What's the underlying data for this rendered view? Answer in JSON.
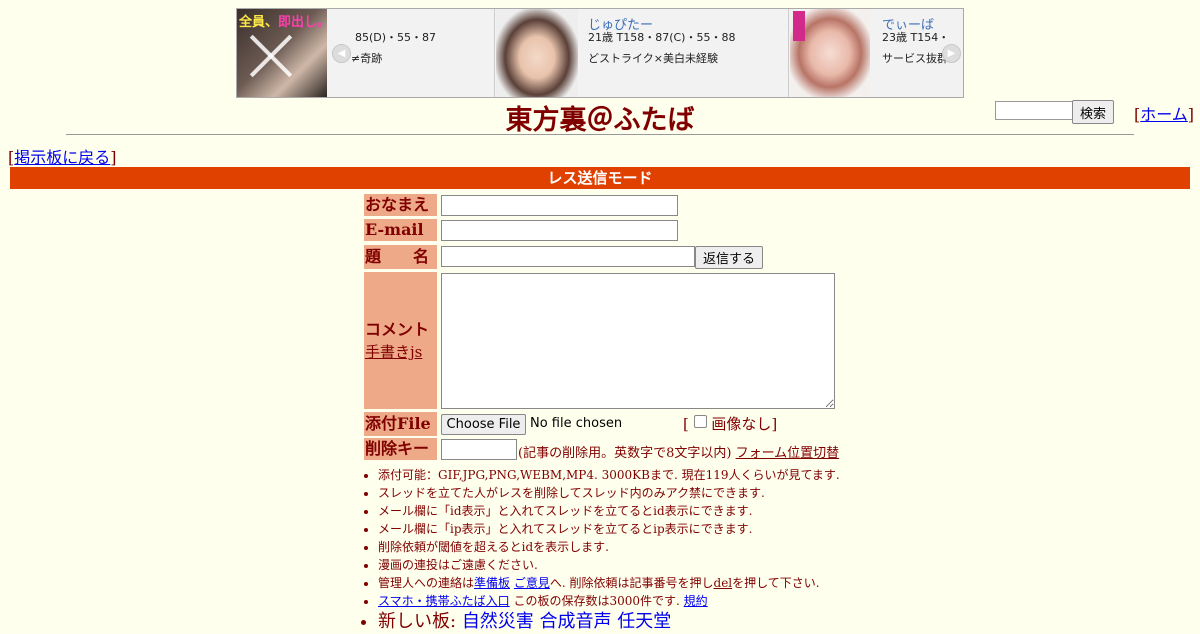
{
  "banner": {
    "ad1": {
      "badge": "全員、",
      "badge_pink": "即出し。",
      "line1": "85(D)・55・87",
      "line2": "≠奇跡"
    },
    "ad2": {
      "name": "じゅぴたー",
      "line1": "21歳 T158・87(C)・55・88",
      "line2": "どストライク×美白未経験"
    },
    "ad3": {
      "name": "でぃーば",
      "line1": "23歳 T154・",
      "line2": "サービス抜群"
    },
    "prev_icon": "chevron-left-icon",
    "next_icon": "chevron-right-icon"
  },
  "header": {
    "title": "東方裏＠ふたば",
    "search_button": "検索",
    "home_link": "ホーム",
    "back_link": "掲示板に戻る"
  },
  "mode_bar": "レス送信モード",
  "form": {
    "name_label": "おなまえ",
    "email_label": "E-mail",
    "subject_label": "題　　名",
    "submit_button": "返信する",
    "comment_label": "コメント",
    "tegaki_link": "手書きjs",
    "file_label": "添付File",
    "choose_file_button": "Choose File",
    "no_file_text": "No file chosen",
    "no_image_label": "画像なし",
    "delkey_label": "削除キー",
    "delkey_note": "(記事の削除用。英数字で8文字以内)",
    "form_toggle_link": "フォーム位置切替"
  },
  "notes": {
    "n1": "添付可能：GIF,JPG,PNG,WEBM,MP4. 3000KBまで. 現在119人くらいが見てます.",
    "n2": "スレッドを立てた人がレスを削除してスレッド内のみアク禁にできます.",
    "n3": "メール欄に「id表示」と入れてスレッドを立てるとid表示にできます.",
    "n4": "メール欄に「ip表示」と入れてスレッドを立てるとip表示にできます.",
    "n5": "削除依頼が閾値を超えるとidを表示します.",
    "n6": "漫画の連投はご遠慮ください.",
    "n7_pre": "管理人への連絡は",
    "n7_link1": "準備板",
    "n7_link2": "ご意見",
    "n7_mid": "へ. 削除依頼は記事番号を押し",
    "n7_del": "del",
    "n7_post": "を押して下さい.",
    "n8_link": "スマホ・携帯ふたば入口",
    "n8_text": "この板の保存数は3000件です.",
    "n8_rules": "規約",
    "n9_prefix": "新しい板:",
    "n9_board1": "自然災害",
    "n9_board2": "合成音声",
    "n9_board3": "任天堂"
  },
  "colors": {
    "background": "#FFFFEE",
    "text": "#800000",
    "mode_bar": "#E04000",
    "label_bg": "#EEAA88",
    "link": "#0000EE"
  }
}
